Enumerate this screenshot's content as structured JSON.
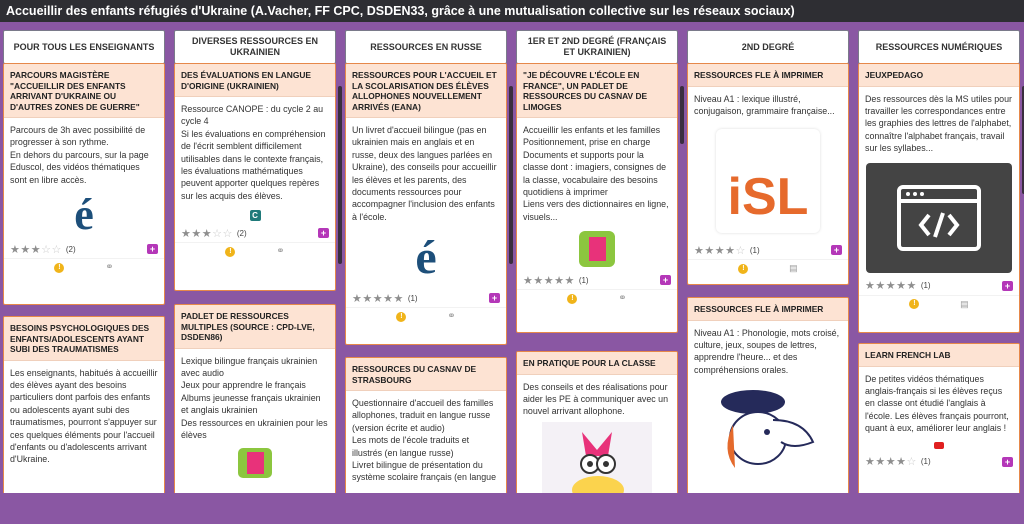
{
  "board": {
    "title": "Accueillir des enfants réfugiés d'Ukraine (A.Vacher, FF CPC, DSDEN33, grâce à une mutualisation collective sur les réseaux sociaux)"
  },
  "colors": {
    "background": "#8a57a3",
    "card_border": "#e6884a",
    "card_title_bg": "#fde3d3",
    "add_button": "#d6336c",
    "comment_badge": "#b437b8"
  },
  "columns": [
    {
      "title": "POUR TOUS LES ENSEIGNANTS",
      "add_label": "+"
    },
    {
      "title": "DIVERSES RESSOURCES EN UKRAINIEN",
      "add_label": "+"
    },
    {
      "title": "RESSOURCES EN RUSSE",
      "add_label": "+"
    },
    {
      "title": "1ER ET 2ND DEGRÉ (FRANÇAIS ET UKRAINIEN)",
      "add_label": "+"
    },
    {
      "title": "2ND DEGRÉ",
      "add_label": "+"
    },
    {
      "title": "RESSOURCES NUMÉRIQUES",
      "add_label": "+"
    }
  ],
  "cards": {
    "c1a": {
      "title": "PARCOURS MAGISTÈRE \"ACCUEILLIR DES ENFANTS ARRIVANT D'UKRAINE OU D'AUTRES ZONES DE GUERRE\"",
      "lines": [
        "Parcours de 3h avec possibilité de progresser à son rythme.",
        "En dehors du parcours, sur la page Eduscol, des vidéos thématiques sont en libre accès."
      ],
      "thumb_text": "é",
      "rating": 3,
      "count": "(2)",
      "comment": "+"
    },
    "c1b": {
      "title": "BESOINS PSYCHOLOGIQUES DES ENFANTS/ADOLESCENTS AYANT SUBI DES TRAUMATISMES",
      "lines": [
        "Les enseignants, habitués à accueillir des élèves ayant des besoins particuliers dont parfois des enfants ou adolescents ayant subi des traumatismes, pourront s'appuyer sur ces quelques éléments pour l'accueil d'enfants ou d'adolescents arrivant d'Ukraine."
      ]
    },
    "c2a": {
      "title": "DES ÉVALUATIONS EN LANGUE D'ORIGINE (UKRAINIEN)",
      "lines": [
        "Ressource CANOPE : du cycle 2 au cycle 4",
        "Si les évaluations en compréhension de l'écrit semblent difficilement utilisables dans le contexte français, les évaluations mathématiques peuvent apporter quelques repères sur les acquis des élèves."
      ],
      "thumb_text": "C",
      "rating": 3,
      "count": "(2)",
      "comment": "+"
    },
    "c2b": {
      "title": "PADLET DE RESSOURCES MULTIPLES (SOURCE : CPD-LVE, DSDEN86)",
      "lines": [
        "Lexique bilingue français ukrainien avec audio",
        "Jeux pour apprendre le français",
        "Albums jeunesse français ukrainien et anglais ukrainien",
        "Des ressources en ukrainien pour les élèves"
      ]
    },
    "c3a": {
      "title": "RESSOURCES POUR L'ACCUEIL ET LA SCOLARISATION DES ÉLÈVES ALLOPHONES NOUVELLEMENT ARRIVÉS (EANA)",
      "lines": [
        "Un livret d'accueil bilingue (pas en ukrainien mais en anglais et en russe, deux des langues parlées en Ukraine), des conseils pour accueillir les élèves et les parents, des documents ressources pour accompagner l'inclusion des enfants à l'école."
      ],
      "thumb_text": "é",
      "rating": 5,
      "count": "(1)",
      "comment": "+"
    },
    "c3b": {
      "title": "RESSOURCES DU CASNAV DE STRASBOURG",
      "lines": [
        "Questionnaire d'accueil des familles allophones, traduit en langue russe (version écrite et audio)",
        "Les mots de l'école traduits et illustrés (en langue russe)",
        "Livret bilingue de présentation du système scolaire français (en langue"
      ]
    },
    "c4a": {
      "title": "\"JE DÉCOUVRE L'ÉCOLE EN FRANCE\", UN PADLET DE RESSOURCES DU CASNAV DE LIMOGES",
      "lines": [
        "Accueillir les enfants et les familles",
        "Positionnement, prise en charge",
        "Documents et supports pour la classe dont : imagiers, consignes de la classe, vocabulaire des besoins quotidiens à imprimer",
        "Liens vers des dictionnaires en ligne, visuels..."
      ],
      "rating": 5,
      "count": "(1)",
      "comment": "+"
    },
    "c4b": {
      "title": "EN PRATIQUE POUR LA CLASSE",
      "lines": [
        "Des conseils et des réalisations pour aider les PE à communiquer avec un nouvel arrivant allophone."
      ]
    },
    "c5a": {
      "title": "RESSOURCES FLE À IMPRIMER",
      "lines": [
        "Niveau A1 : lexique illustré, conjugaison, grammaire française..."
      ],
      "thumb_text": "iSL",
      "rating": 4,
      "count": "(1)",
      "comment": "+"
    },
    "c5b": {
      "title": "RESSOURCES FLE À IMPRIMER",
      "lines": [
        "Niveau A1 : Phonologie, mots croisé, culture, jeux, soupes de lettres, apprendre l'heure... et des compréhensions orales."
      ]
    },
    "c6a": {
      "title": "JEUXPEDAGO",
      "lines": [
        "Des ressources dès la MS utiles pour travailler les correspondances entre les graphies des lettres de l'alphabet, connaître l'alphabet français, travail sur les syllabes..."
      ],
      "rating": 5,
      "count": "(1)",
      "comment": "+"
    },
    "c6b": {
      "title": "LEARN FRENCH LAB",
      "lines": [
        "De petites vidéos thématiques anglais-français si les élèves reçus en classe ont étudié l'anglais à l'école. Les élèves français pourront, quant à eux, améliorer leur anglais !"
      ],
      "rating": 4,
      "count": "(1)",
      "comment": "+"
    }
  }
}
